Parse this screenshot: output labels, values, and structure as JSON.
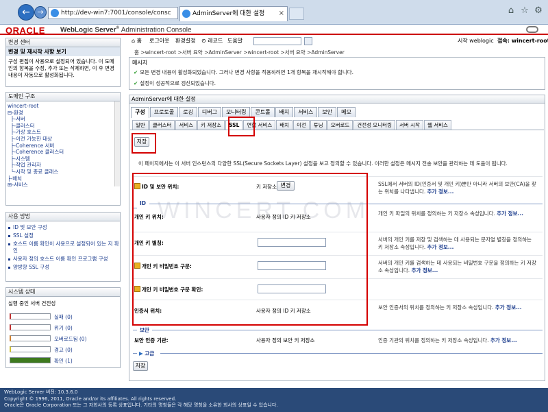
{
  "browser": {
    "address": "http://dev-win7:7001/console/consc",
    "address_tools": "ρ ▾ ⊠ C",
    "tab_title": "AdminServer에 대한 설정"
  },
  "header": {
    "logo": "ORACLE",
    "product": "WebLogic Server",
    "product_sup": "®",
    "console": "Administration Console"
  },
  "change_center": {
    "title": "변경 센터",
    "subtitle": "변경 및 재시작 사항 보기",
    "text": "구성 편집이 사용으로 설정되어 있습니다. 이 도메인의 항목을 수정, 추가 또는 삭제하면, 이 후 변경 내용이 자동으로 활성화됩니다."
  },
  "domain_structure": {
    "title": "도메인 구조",
    "items": [
      "wincert-root",
      "⊟-환경",
      "  ├-서버",
      "  ├-클러스터",
      "  ├-가상 호스트",
      "  ├-이전 가능한 대상",
      "  ├-Coherence 서버",
      "  ├-Coherence 클러스터",
      "  ├-시스템",
      "  ├-작업 관리자",
      "  └-시작 및 종료 클래스",
      "├-배치",
      "⊞-서비스",
      "└-보안 영역"
    ]
  },
  "how_do_i": {
    "title": "사용 방법",
    "items": [
      "ID 및 보안 구성",
      "SSL 설정",
      "호스트 이름 확인이 사용으로 설정되어 있는 지 확인",
      "사용자 정의 호스트 이름 확인 프로그램 구성",
      "양방향 SSL 구성"
    ]
  },
  "system_status": {
    "title": "시스템 상태",
    "subtitle": "실행 중인 서버 건전성",
    "rows": [
      {
        "label": "실패 (0)",
        "fill": 0,
        "color": "#c03030"
      },
      {
        "label": "위기 (0)",
        "fill": 0,
        "color": "#c03030"
      },
      {
        "label": "오버로드됨 (0)",
        "fill": 0,
        "color": "#d08030"
      },
      {
        "label": "경고 (0)",
        "fill": 0,
        "color": "#d0c030"
      },
      {
        "label": "확인 (1)",
        "fill": 1,
        "color": "#3e7a1e"
      }
    ]
  },
  "toolbar": {
    "home": "홈",
    "logout": "로그아웃",
    "prefs": "환경설정",
    "record": "레코드",
    "help": "도움말",
    "started": "시작 weblogic",
    "connected": "접속: wincert-root"
  },
  "breadcrumb": "홈 >wincert-root >서버 요약 >AdminServer >wincert-root >서버 요약 >AdminServer",
  "messages": {
    "title": "메시지",
    "m1": "모든 변경 내용이 활성화되었습니다. 그러나 변경 사항을 적용하려면 1개 항목을 재시작해야 합니다.",
    "m2": "설정이 성공적으로 갱신되었습니다."
  },
  "settings": {
    "title": "AdminServer에 대한 설정",
    "tabs": [
      "구성",
      "프로토콜",
      "로깅",
      "디버그",
      "모니터링",
      "콘트롤",
      "배치",
      "서비스",
      "보안",
      "메모"
    ],
    "subtabs": [
      "일반",
      "클러스터",
      "서비스",
      "키 저장소",
      "SSL",
      "연합 서비스",
      "배치",
      "이전",
      "튜닝",
      "오버로드",
      "건전성 모니터링",
      "서버 시작",
      "웹 서비스"
    ],
    "save": "저장",
    "description": "이 페이지에서는 이 서버 인스턴스의 다양한 SSL(Secure Sockets Layer) 설정을 보고 정의할 수 있습니다. 이러한 설정은 메시지 전송 보안을 관리하는 데 도움이 됩니다.",
    "id_row": {
      "label": "ID 및 보안 위치:",
      "value": "키 저장소",
      "button": "변경",
      "help": "SSL에서 서버의 ID(인증서 및 개인 키)뿐만 아니라 서버의 보안(CA)을 찾는 위치를 나타냅니다.",
      "more": "추가 정보..."
    },
    "section_id": "ID",
    "fields": [
      {
        "label": "개인 키 위치:",
        "value": "사용자 정의 ID 키 저장소",
        "help": "개인 키 파일의 위치를 정의하는 키 저장소 속성입니다.",
        "more": "추가 정보..."
      },
      {
        "label": "개인 키 별칭:",
        "value": "",
        "help": "서버의 개인 키를 저장 및 검색하는 데 사용되는 문자열 별칭을 정의하는 키 저장소 속성입니다.",
        "more": "추가 정보..."
      },
      {
        "label": "개인 키 비밀번호 구문:",
        "value": "",
        "help": "서버의 개인 키를 검색하는 데 사용되는 비밀번호 구문을 정의하는 키 저장소 속성입니다.",
        "more": "추가 정보..."
      },
      {
        "label": "개인 키 비밀번호 구문 확인:",
        "value": "",
        "help": "",
        "more": ""
      },
      {
        "label": "인증서 위치:",
        "value": "사용자 정의 ID 키 저장소",
        "help": "보안 인증서의 위치를 정의하는 키 저장소 속성입니다.",
        "more": "추가 정보..."
      }
    ],
    "section_trust": "보안",
    "trust": {
      "label": "보안 인증 기관:",
      "value": "사용자 정의 보안 키 저장소",
      "help": "인증 기관의 위치를 정의하는 키 저장소 속성입니다.",
      "more": "추가 정보..."
    },
    "section_adv": "고급"
  },
  "watermark": "WINCERT.COM",
  "footer": {
    "version": "WebLogic Server 버전: 10.3.6.0",
    "copyright": "Copyright © 1996, 2011, Oracle and/or its affiliates. All rights reserved.",
    "trademark": "Oracle은 Oracle Corporation 또는 그 자회사의 등록 상표입니다. 기타의 명칭들은 각 해당 명칭을 소유한 회사의 상표일 수 있습니다."
  }
}
